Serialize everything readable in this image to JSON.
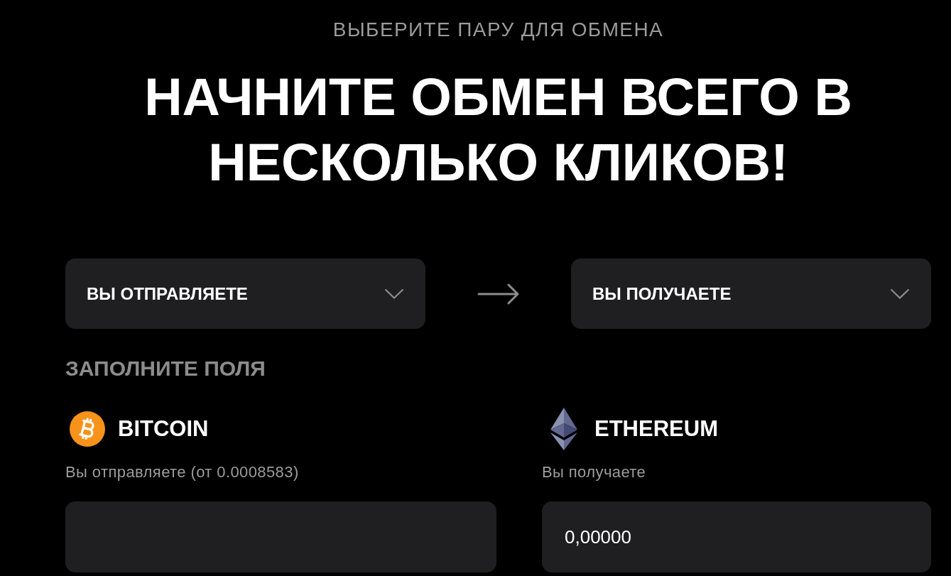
{
  "subtitle": "ВЫБЕРИТЕ ПАРУ ДЛЯ ОБМЕНА",
  "heading": "НАЧНИТЕ ОБМЕН ВСЕГО В НЕСКОЛЬКО КЛИКОВ!",
  "pair": {
    "send": {
      "label": "ВЫ ОТПРАВЛЯЕТЕ"
    },
    "receive": {
      "label": "ВЫ ПОЛУЧАЕТЕ"
    }
  },
  "form": {
    "title": "ЗАПОЛНИТЕ ПОЛЯ",
    "fields": [
      {
        "kind": "bitcoin",
        "coin": "BITCOIN",
        "label": "Вы отправляете (от 0.0008583)"
      },
      {
        "kind": "ethereum",
        "coin": "ETHEREUM",
        "label": "Вы получаете",
        "value": "0,00000"
      }
    ]
  }
}
